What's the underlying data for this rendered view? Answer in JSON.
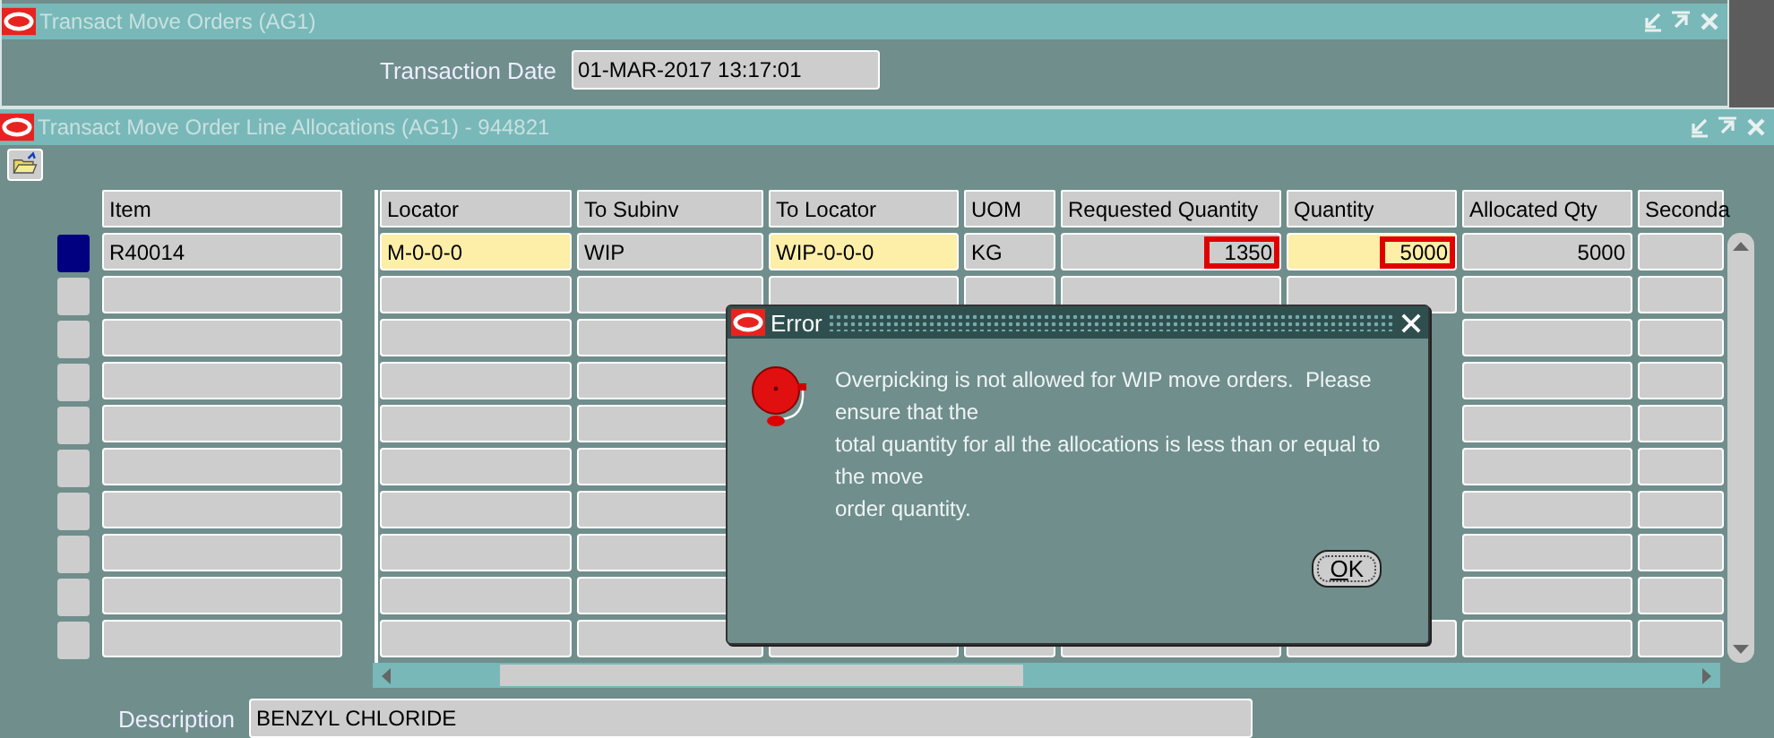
{
  "main_window": {
    "title": "Transact Move Orders (AG1)",
    "date_label": "Transaction Date",
    "date_value": "01-MAR-2017 13:17:01"
  },
  "allocations_window": {
    "title": "Transact Move Order Line Allocations (AG1) - 944821",
    "columns": [
      {
        "label": "Item",
        "kind": "text"
      },
      {
        "label": "Locator",
        "kind": "text"
      },
      {
        "label": "To Subinv",
        "kind": "text"
      },
      {
        "label": "To Locator",
        "kind": "text"
      },
      {
        "label": "UOM",
        "kind": "text"
      },
      {
        "label": "Requested Quantity",
        "kind": "number"
      },
      {
        "label": "Quantity",
        "kind": "number"
      },
      {
        "label": "Allocated Qty",
        "kind": "number"
      },
      {
        "label": "Seconda",
        "kind": "text"
      }
    ],
    "rows": [
      {
        "selected": true,
        "cells": [
          {
            "text": "R40014",
            "mandatory": false,
            "highlighted": false
          },
          {
            "text": "M-0-0-0",
            "mandatory": true,
            "highlighted": false
          },
          {
            "text": "WIP",
            "mandatory": false,
            "highlighted": false
          },
          {
            "text": "WIP-0-0-0",
            "mandatory": true,
            "highlighted": false
          },
          {
            "text": "KG",
            "mandatory": false,
            "highlighted": false
          },
          {
            "text": "1350",
            "mandatory": false,
            "highlighted": true
          },
          {
            "text": "5000",
            "mandatory": true,
            "highlighted": true
          },
          {
            "text": "5000",
            "mandatory": false,
            "highlighted": false
          }
        ]
      },
      {
        "selected": false
      },
      {
        "selected": false
      },
      {
        "selected": false
      },
      {
        "selected": false
      },
      {
        "selected": false
      },
      {
        "selected": false
      },
      {
        "selected": false
      },
      {
        "selected": false
      },
      {
        "selected": false
      }
    ],
    "description": {
      "label": "Description",
      "value": "BENZYL CHLORIDE"
    }
  },
  "error_dialog": {
    "title": "Error",
    "message": "Overpicking is not allowed for WIP move orders.  Please ensure that the\ntotal quantity for all the allocations is less than or equal to the move\norder quantity.",
    "button": "OK"
  }
}
